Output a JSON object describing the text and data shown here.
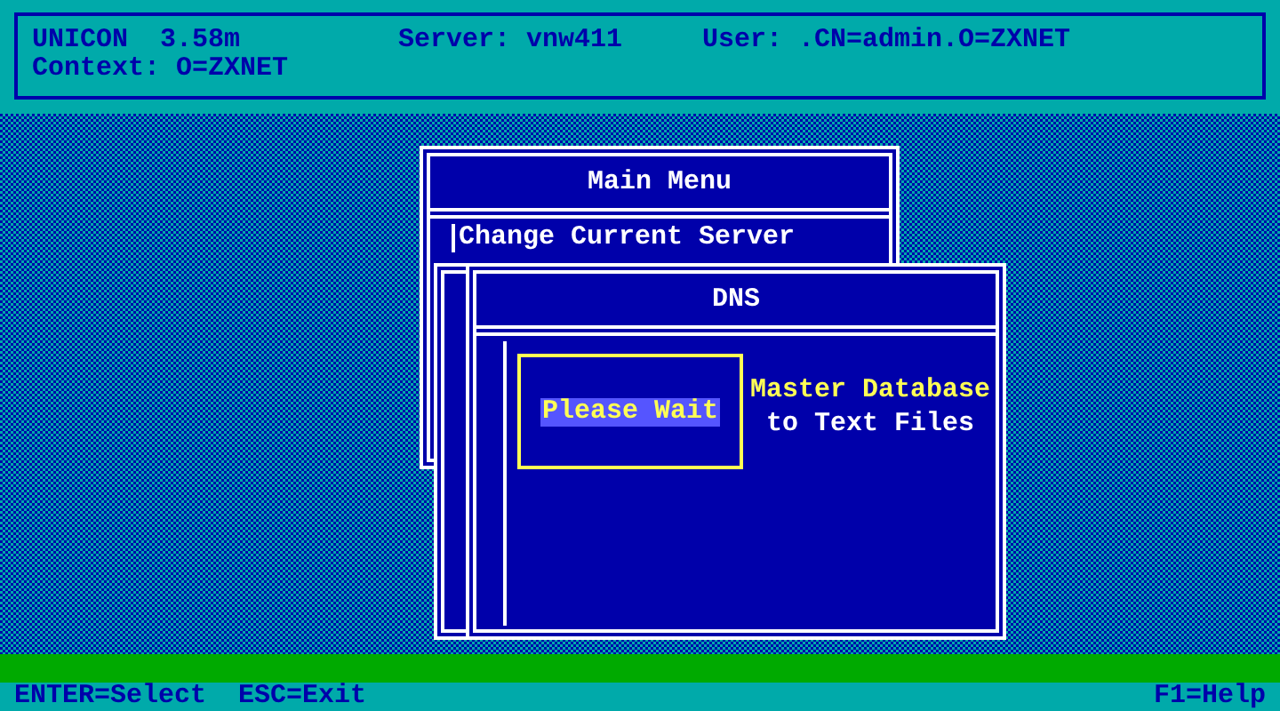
{
  "header": {
    "program": "UNICON",
    "version": "3.58m",
    "server": "Server: vnw411",
    "user": "User: .CN=admin.O=ZXNET",
    "context": "Context: O=ZXNET"
  },
  "main_menu": {
    "title": "Main Menu",
    "items": [
      {
        "label": "Change Current Server",
        "selected": false
      }
    ]
  },
  "dns_dialog": {
    "title": "DNS",
    "message": "Please Wait",
    "option_line_1": "Master Database",
    "option_line_2": "to Text Files"
  },
  "status_bar": {
    "keys": [
      "ENTER=Select",
      "ESC=Exit"
    ],
    "help": "F1=Help"
  }
}
